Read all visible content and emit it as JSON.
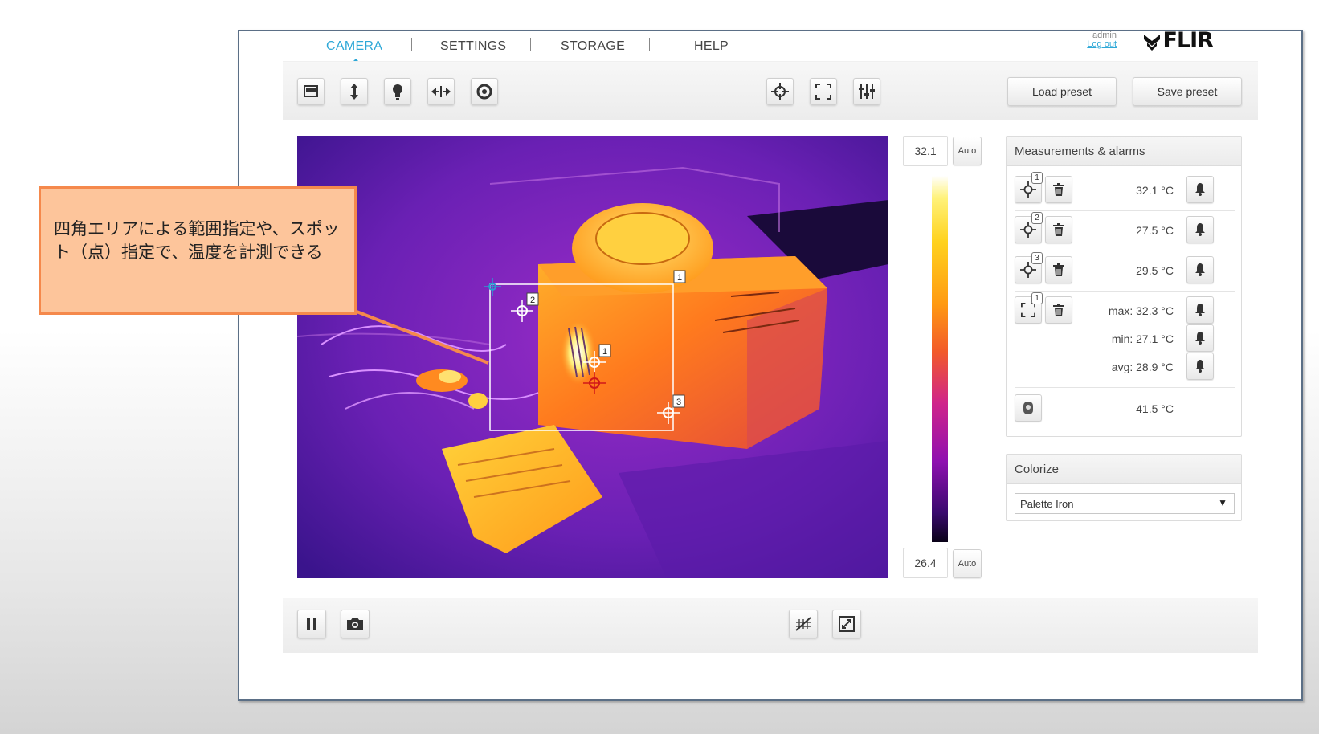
{
  "nav": {
    "tabs": [
      {
        "label": "CAMERA",
        "active": true
      },
      {
        "label": "SETTINGS",
        "active": false
      },
      {
        "label": "STORAGE",
        "active": false
      },
      {
        "label": "HELP",
        "active": false
      }
    ],
    "user": "admin",
    "logout": "Log out",
    "logo_text": "FLIR"
  },
  "toolbar": {
    "left_icons": [
      "display-mode-icon",
      "focus-icon",
      "lamp-icon",
      "flip-icon",
      "shutter-icon"
    ],
    "right_icons": [
      "spot-tool-icon",
      "box-tool-icon",
      "adjust-icon"
    ],
    "load_preset": "Load preset",
    "save_preset": "Save preset"
  },
  "scale": {
    "max": "32.1",
    "min": "26.4",
    "auto_top": "Auto",
    "auto_bottom": "Auto"
  },
  "thermal_labels": {
    "box": "1",
    "spot1": "1",
    "spot2": "2",
    "spot3": "3"
  },
  "measurements": {
    "title": "Measurements & alarms",
    "spots": [
      {
        "badge": "1",
        "value": "32.1 °C"
      },
      {
        "badge": "2",
        "value": "27.5 °C"
      },
      {
        "badge": "3",
        "value": "29.5 °C"
      }
    ],
    "box": {
      "badge": "1",
      "max": "max: 32.3 °C",
      "min": "min: 27.1 °C",
      "avg": "avg: 28.9 °C"
    },
    "internal": {
      "value": "41.5 °C"
    }
  },
  "colorize": {
    "title": "Colorize",
    "selected": "Palette Iron"
  },
  "callout": {
    "text": "四角エリアによる範囲指定や、スポット（点）指定で、温度を計測できる"
  },
  "colors": {
    "accent": "#2ea8d7",
    "callout_fill": "#fdc59b",
    "callout_border": "#f5894c"
  }
}
